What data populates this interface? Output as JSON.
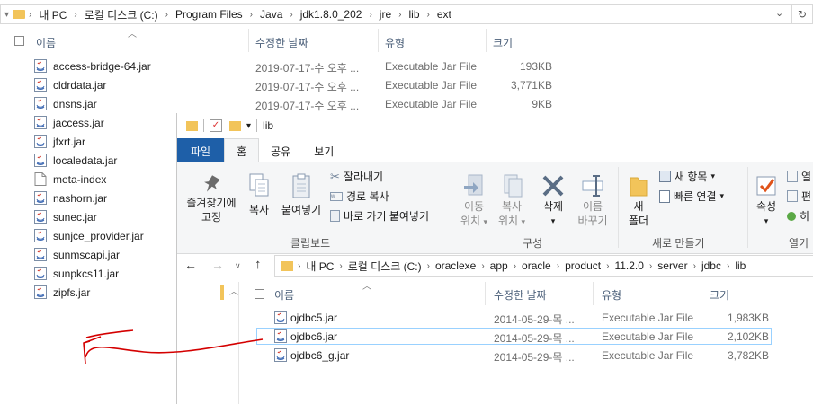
{
  "back_window": {
    "breadcrumb": [
      "내 PC",
      "로컬 디스크 (C:)",
      "Program Files",
      "Java",
      "jdk1.8.0_202",
      "jre",
      "lib",
      "ext"
    ],
    "columns": {
      "name": "이름",
      "date": "수정한 날짜",
      "type": "유형",
      "size": "크기"
    },
    "files_with_details": [
      {
        "name": "access-bridge-64.jar",
        "date": "2019-07-17-수 오후 ...",
        "type": "Executable Jar File",
        "size": "193KB"
      },
      {
        "name": "cldrdata.jar",
        "date": "2019-07-17-수 오후 ...",
        "type": "Executable Jar File",
        "size": "3,771KB"
      },
      {
        "name": "dnsns.jar",
        "date": "2019-07-17-수 오후 ...",
        "type": "Executable Jar File",
        "size": "9KB"
      }
    ],
    "more_files": [
      "jaccess.jar",
      "jfxrt.jar",
      "localedata.jar",
      "meta-index",
      "nashorn.jar",
      "sunec.jar",
      "sunjce_provider.jar",
      "sunmscapi.jar",
      "sunpkcs11.jar",
      "zipfs.jar"
    ]
  },
  "front_window": {
    "title": "lib",
    "tabs": [
      "파일",
      "홈",
      "공유",
      "보기"
    ],
    "ribbon": {
      "pin_label_1": "즐겨찾기에",
      "pin_label_2": "고정",
      "copy": "복사",
      "paste": "붙여넣기",
      "cut": "잘라내기",
      "copy_path": "경로 복사",
      "paste_shortcut": "바로 가기 붙여넣기",
      "clipboard_group": "클립보드",
      "move_1": "이동",
      "move_2": "위치",
      "copyto_1": "복사",
      "copyto_2": "위치",
      "delete": "삭제",
      "rename_1": "이름",
      "rename_2": "바꾸기",
      "organize_group": "구성",
      "new_item": "새 항목",
      "easy_access": "빠른 연결",
      "new_folder_1": "새",
      "new_folder_2": "폴더",
      "new_group": "새로 만들기",
      "properties": "속성",
      "open_group": "열기",
      "open_small_1": "열",
      "open_small_2": "편",
      "open_small_3": "히"
    },
    "breadcrumb": [
      "내 PC",
      "로컬 디스크 (C:)",
      "oraclexe",
      "app",
      "oracle",
      "product",
      "11.2.0",
      "server",
      "jdbc",
      "lib"
    ],
    "columns": {
      "name": "이름",
      "date": "수정한 날짜",
      "type": "유형",
      "size": "크기"
    },
    "files": [
      {
        "name": "ojdbc5.jar",
        "date": "2014-05-29-목 ...",
        "type": "Executable Jar File",
        "size": "1,983KB"
      },
      {
        "name": "ojdbc6.jar",
        "date": "2014-05-29-목 ...",
        "type": "Executable Jar File",
        "size": "2,102KB"
      },
      {
        "name": "ojdbc6_g.jar",
        "date": "2014-05-29-목 ...",
        "type": "Executable Jar File",
        "size": "3,782KB"
      }
    ]
  },
  "colors": {
    "file_tab": "#1e5fa8",
    "annotation_arrow": "#d40000",
    "selection_border": "#99d1ff",
    "header_text": "#4c607a"
  }
}
